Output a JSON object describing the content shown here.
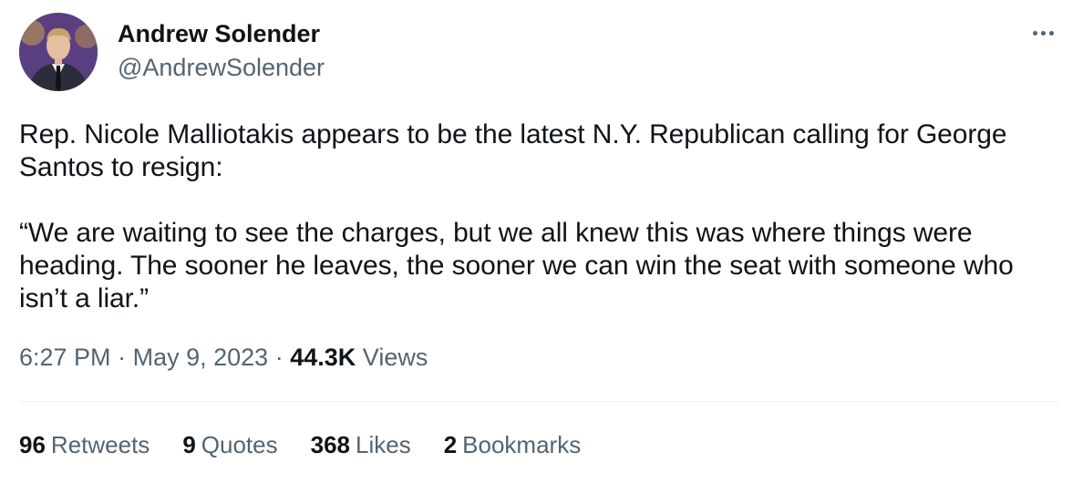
{
  "author": {
    "name": "Andrew Solender",
    "handle": "@AndrewSolender",
    "avatar_icon": "avatar-photo"
  },
  "tweet": {
    "paragraphs": [
      "Rep. Nicole Malliotakis appears to be the latest N.Y. Republican calling for George Santos to resign:",
      "“We are waiting to see the charges, but we all knew this was where things were heading. The sooner he leaves, the sooner we can win the seat with someone who isn’t a liar.”"
    ],
    "time": "6:27 PM",
    "date": "May 9, 2023",
    "separator": "·",
    "views_count": "44.3K",
    "views_label": "Views"
  },
  "stats": {
    "retweets": {
      "count": "96",
      "label": "Retweets"
    },
    "quotes": {
      "count": "9",
      "label": "Quotes"
    },
    "likes": {
      "count": "368",
      "label": "Likes"
    },
    "bookmarks": {
      "count": "2",
      "label": "Bookmarks"
    }
  },
  "menu_icon": "more-options-icon",
  "colors": {
    "text": "#0f1419",
    "secondary": "#536471",
    "divider": "#eff3f4"
  }
}
